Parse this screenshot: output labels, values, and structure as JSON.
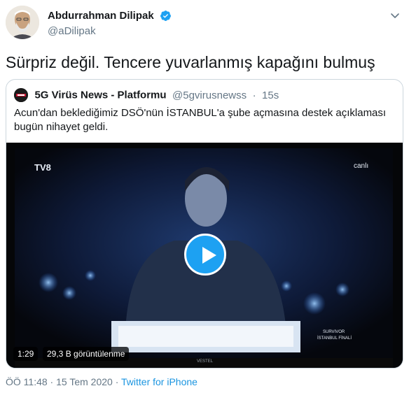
{
  "author": {
    "display_name": "Abdurrahman Dilipak",
    "handle": "@aDilipak"
  },
  "tweet": {
    "text": "Sürpriz değil. Tencere yuvarlanmış kapağını bulmuş"
  },
  "quoted": {
    "name": "5G Virüs News - Platformu",
    "handle": "@5gvirusnewss",
    "time": "15s",
    "separator": "·",
    "text_line1": "Acun'dan beklediğimiz DSÖ'nün İSTANBUL'a şube açmasına destek açıklaması",
    "text_line2": "bugün nihayet  geldi.",
    "video": {
      "duration": "1:29",
      "views": "29,3 B görüntülenme",
      "tv_logo": "TV8",
      "live_label": "canlı",
      "show_label_1": "SURVIVOR",
      "show_label_2": "İSTANBUL FİNALİ",
      "brand": "VESTEL"
    }
  },
  "footer": {
    "time_date": "ÖÖ 11:48 · 15 Tem 2020",
    "separator": "·",
    "source": "Twitter for iPhone"
  },
  "colors": {
    "accent": "#1da1f2",
    "secondary_text": "#657786",
    "border": "#ccd6dd"
  }
}
